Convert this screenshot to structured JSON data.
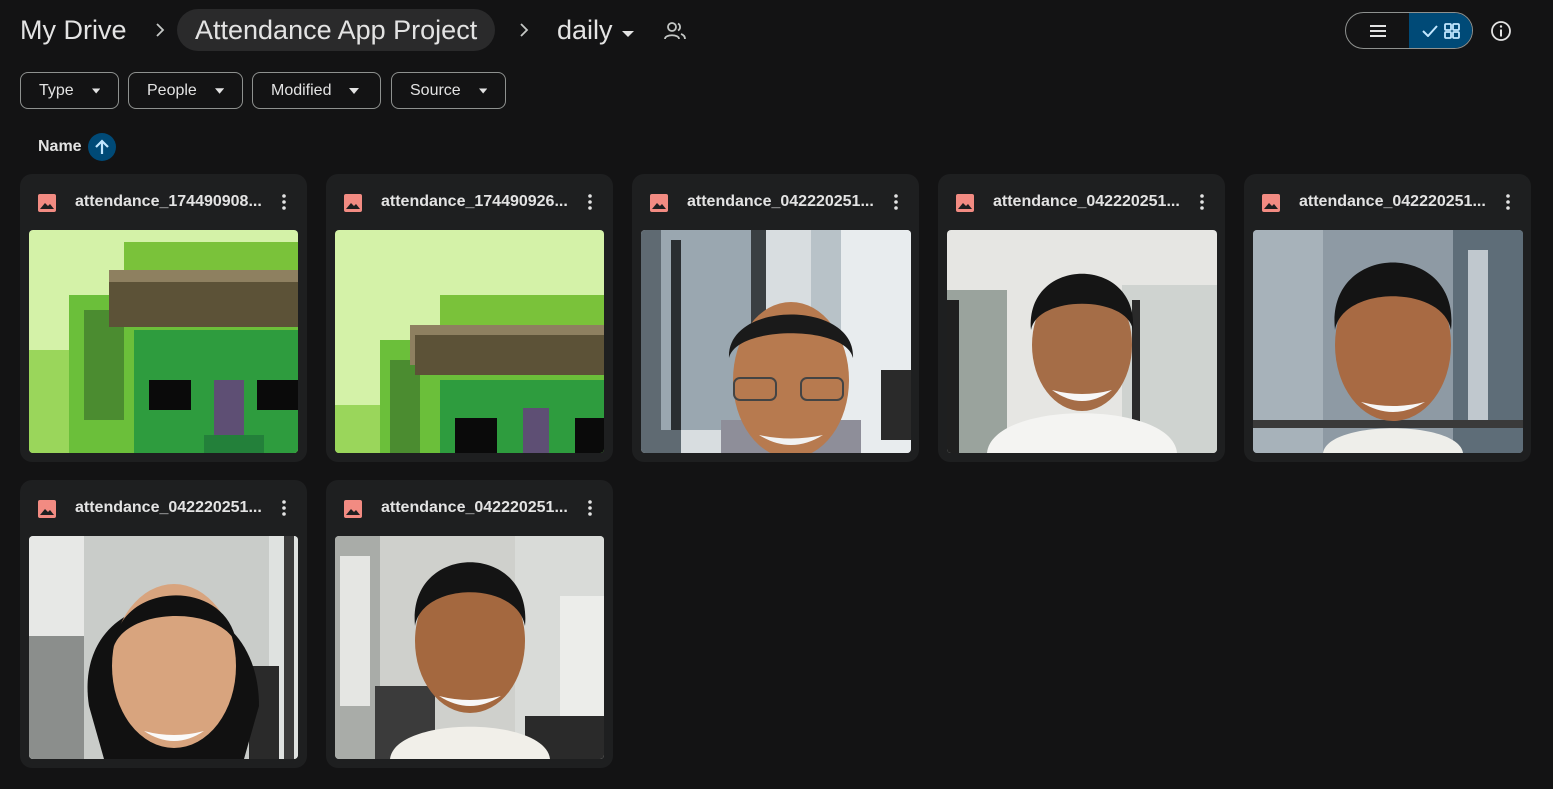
{
  "breadcrumb": {
    "root": "My Drive",
    "project": "Attendance App Project",
    "current": "daily"
  },
  "icons": {
    "separator": "chevron-right-icon",
    "dropdown": "caret-down-icon",
    "shared": "shared-people-icon",
    "list_view": "list-view-icon",
    "grid_view": "grid-view-icon",
    "check": "check-icon",
    "info": "info-icon",
    "sort": "arrow-up-icon",
    "file": "image-file-icon",
    "more": "more-vert-icon"
  },
  "filters": [
    {
      "label": "Type"
    },
    {
      "label": "People"
    },
    {
      "label": "Modified"
    },
    {
      "label": "Source"
    }
  ],
  "sort": {
    "label": "Name",
    "direction": "ascending"
  },
  "files": [
    {
      "name": "attendance_174490908...",
      "thumbnail": "green-pixel-house"
    },
    {
      "name": "attendance_174490926...",
      "thumbnail": "green-pixel-house"
    },
    {
      "name": "attendance_042220251...",
      "thumbnail": "man-glasses-office-window"
    },
    {
      "name": "attendance_042220251...",
      "thumbnail": "man-smiling-office"
    },
    {
      "name": "attendance_042220251...",
      "thumbnail": "man-smiling-city-window"
    },
    {
      "name": "attendance_042220251...",
      "thumbnail": "woman-smiling-office"
    },
    {
      "name": "attendance_042220251...",
      "thumbnail": "man-smiling-office-blinds"
    }
  ],
  "colors": {
    "background": "#131314",
    "card": "#1e1f20",
    "accent": "#004a77",
    "file_icon": "#f28b82",
    "text": "#e3e3e3"
  }
}
